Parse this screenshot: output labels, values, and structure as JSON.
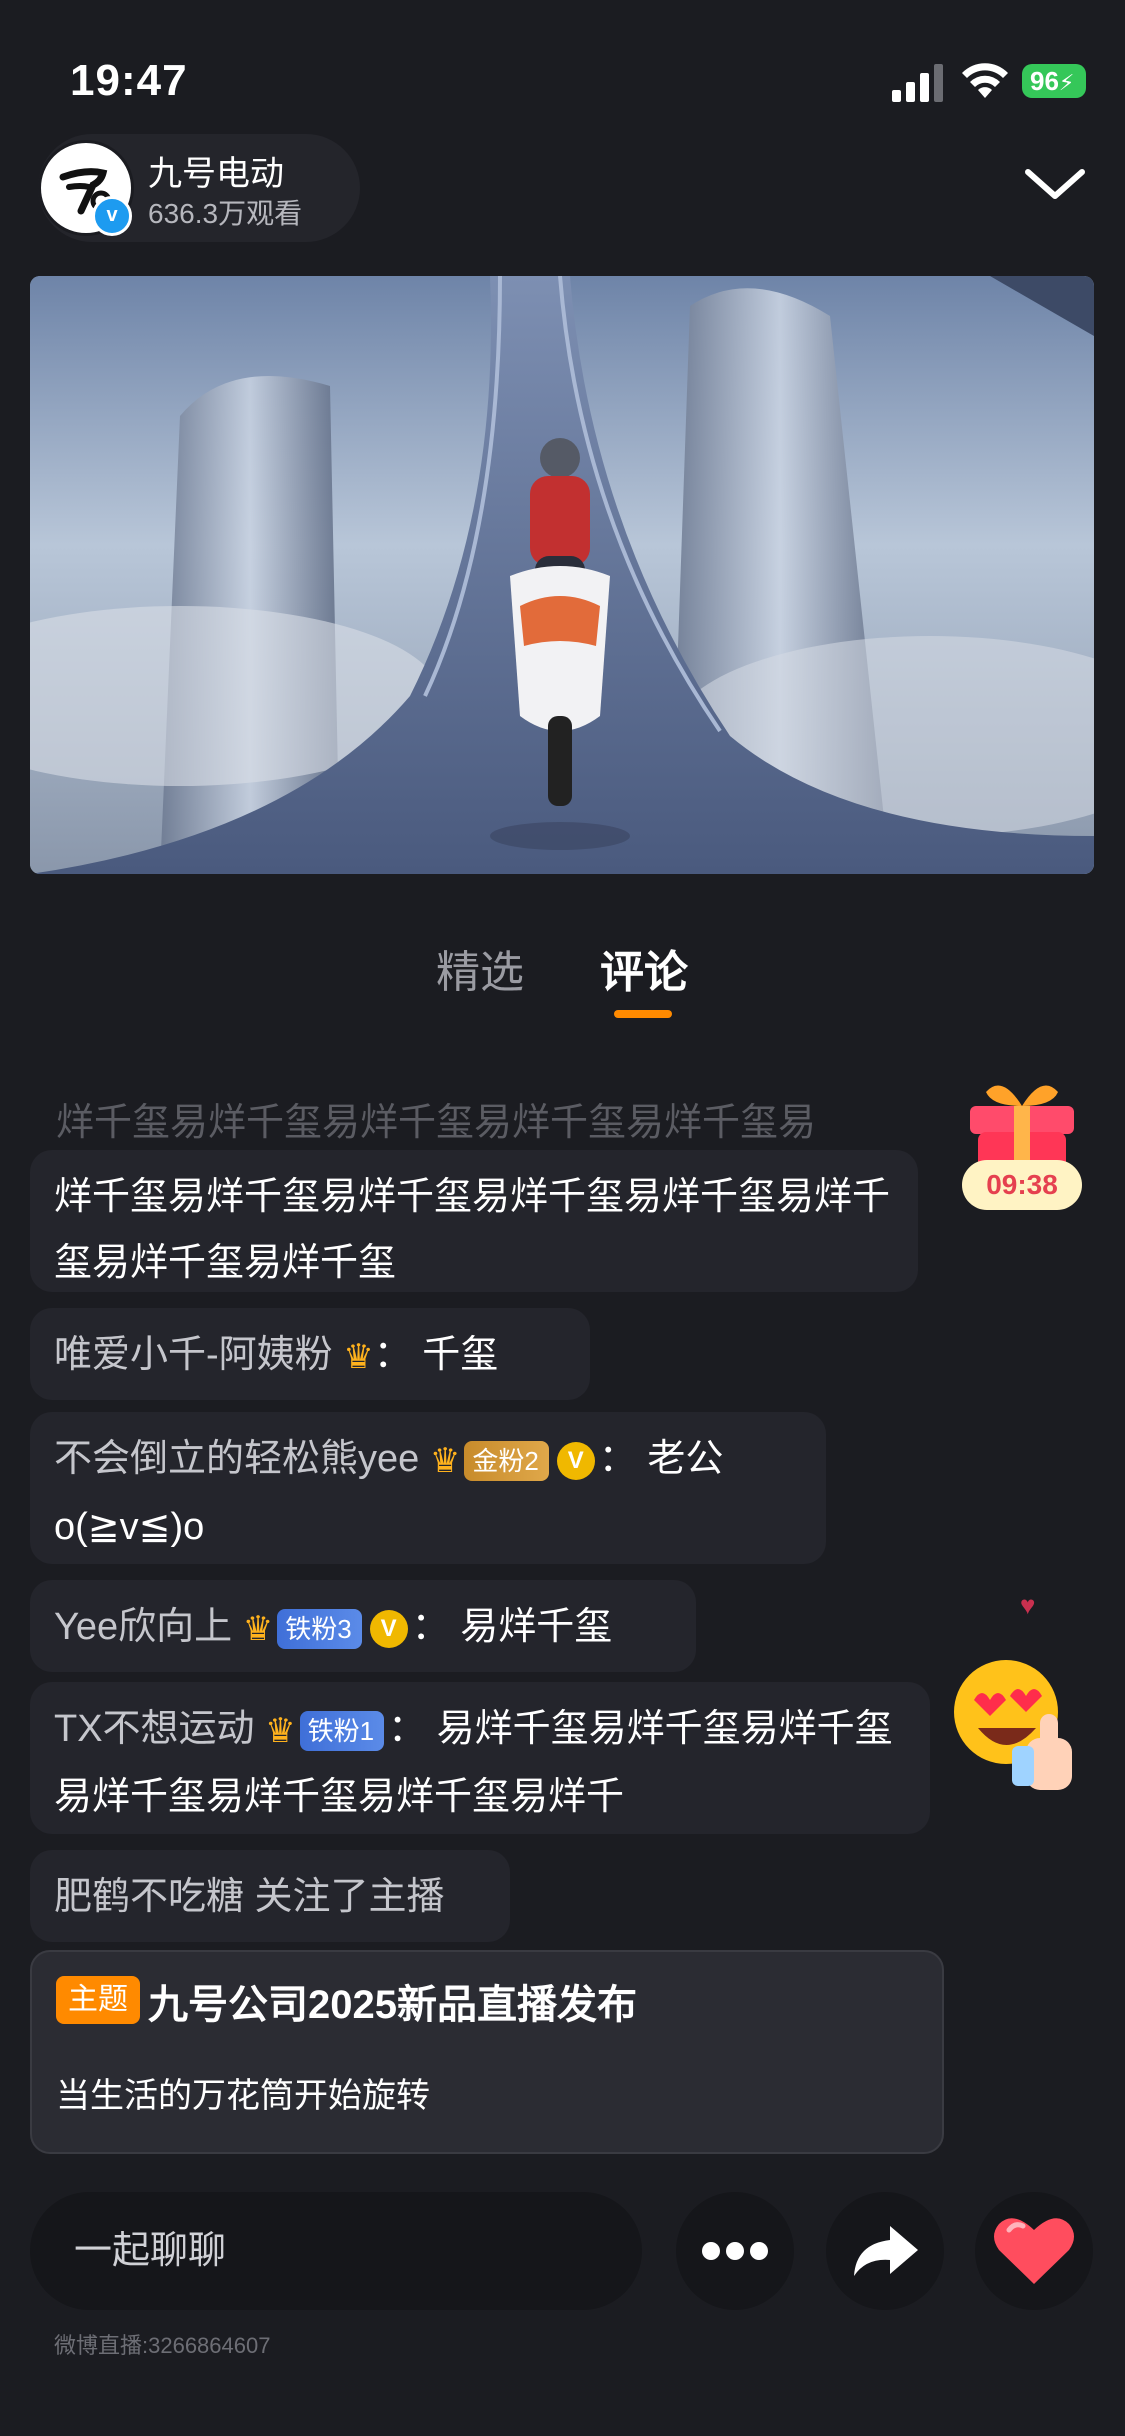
{
  "status_bar": {
    "time": "19:47",
    "battery": "96"
  },
  "host": {
    "name": "九号电动",
    "views": "636.3万观看",
    "verified_mark": "v"
  },
  "tabs": [
    {
      "label": "精选",
      "active": false
    },
    {
      "label": "评论",
      "active": true
    }
  ],
  "gift": {
    "timer": "09:38"
  },
  "comments": {
    "faded_line": "烊千玺易烊千玺易烊千玺易烊千玺易烊千玺易",
    "c1": {
      "text": "烊千玺易烊千玺易烊千玺易烊千玺易烊千玺易烊千玺易烊千玺易烊千玺"
    },
    "c2": {
      "user": "唯爱小千-阿姨粉",
      "sep": "：",
      "text": "千玺"
    },
    "c3": {
      "user": "不会倒立的轻松熊yee",
      "badge": "金粉2",
      "vmark": "V",
      "sep": "：",
      "text": "老公o(≧v≦)o"
    },
    "c4": {
      "user": "Yee欣向上",
      "badge": "铁粉3",
      "vmark": "V",
      "sep": "：",
      "text": "易烊千玺"
    },
    "c5": {
      "user": "TX不想运动",
      "badge": "铁粉1",
      "sep": "：",
      "text": "易烊千玺易烊千玺易烊千玺易烊千玺易烊千玺易烊千玺易烊千"
    },
    "c6": {
      "text": "肥鹤不吃糖 关注了主播"
    }
  },
  "topic": {
    "tag": "主题",
    "title": "九号公司2025新品直播发布",
    "description": "当生活的万花筒开始旋转"
  },
  "bottom_bar": {
    "chat_placeholder": "一起聊聊",
    "footer_id": "微博直播:3266864607"
  },
  "colors": {
    "accent": "#ff8a00",
    "background": "#1b1c21",
    "like": "#ff4d5e"
  }
}
